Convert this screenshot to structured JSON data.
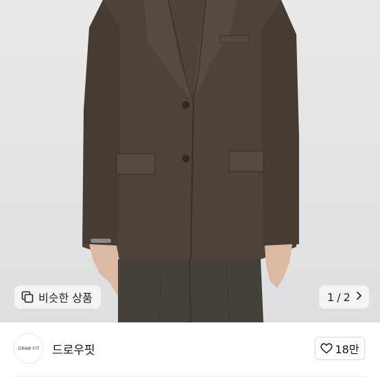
{
  "gallery": {
    "similar_label": "비슷한 상품",
    "page_current": "1",
    "page_sep": "/",
    "page_total": "2"
  },
  "shop": {
    "logo_text": "DRAW FIT",
    "name": "드로우핏",
    "like_count": "18만"
  },
  "colors": {
    "jacket": "#4d4339",
    "trousers": "#46403a",
    "background": "#e4e4e5"
  },
  "icons": {
    "similar": "copy-icon",
    "next": "chevron-right-icon",
    "like": "heart-icon"
  }
}
